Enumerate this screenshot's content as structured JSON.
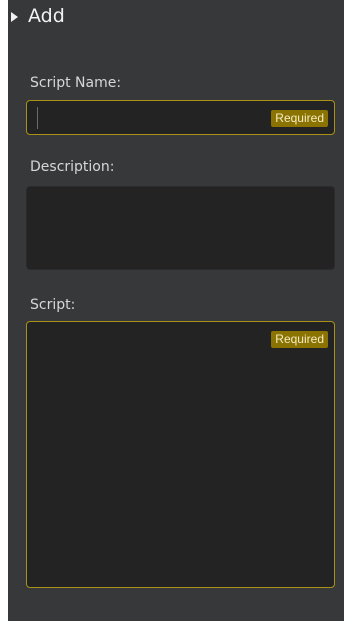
{
  "section": {
    "title": "Add",
    "icon": "caret-right-icon"
  },
  "fields": {
    "script_name": {
      "label": "Script Name:",
      "value": "",
      "required_badge": "Required"
    },
    "description": {
      "label": "Description:",
      "value": ""
    },
    "script": {
      "label": "Script:",
      "value": "",
      "required_badge": "Required"
    }
  },
  "colors": {
    "panel_bg": "#37383a",
    "field_bg": "#232324",
    "required_border": "#a89116",
    "badge_bg": "#8a7300"
  }
}
